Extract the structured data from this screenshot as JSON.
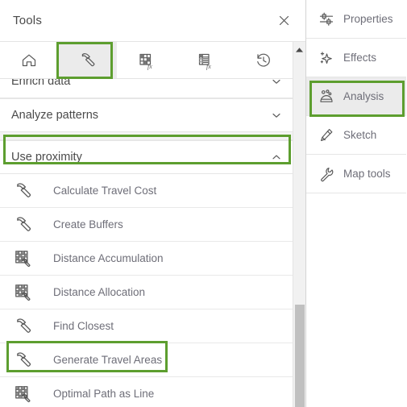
{
  "panel": {
    "title": "Tools",
    "close_icon": "close-icon"
  },
  "tabs": [
    {
      "id": "favorites",
      "icon": "home-icon",
      "selected": false
    },
    {
      "id": "toolboxes",
      "icon": "hammer-icon",
      "selected": true
    },
    {
      "id": "raster-functions",
      "icon": "raster-function-icon",
      "selected": false
    },
    {
      "id": "portal-functions",
      "icon": "table-function-icon",
      "selected": false
    },
    {
      "id": "history",
      "icon": "history-clock-icon",
      "selected": false
    }
  ],
  "sections": [
    {
      "id": "enrich-data",
      "label": "Enrich data",
      "expanded": false,
      "chevron": "chevron-down-icon"
    },
    {
      "id": "analyze-patterns",
      "label": "Analyze patterns",
      "expanded": false,
      "chevron": "chevron-down-icon"
    },
    {
      "id": "use-proximity",
      "label": "Use proximity",
      "expanded": true,
      "chevron": "chevron-up-icon"
    }
  ],
  "tools": [
    {
      "label": "Calculate Travel Cost",
      "icon": "hammer-icon"
    },
    {
      "label": "Create Buffers",
      "icon": "hammer-icon"
    },
    {
      "label": "Distance Accumulation",
      "icon": "raster-hammer-icon"
    },
    {
      "label": "Distance Allocation",
      "icon": "raster-hammer-icon"
    },
    {
      "label": "Find Closest",
      "icon": "hammer-icon"
    },
    {
      "label": "Generate Travel Areas",
      "icon": "hammer-icon"
    },
    {
      "label": "Optimal Path as Line",
      "icon": "raster-hammer-icon"
    }
  ],
  "scrollbar": {
    "up_arrow_icon": "scroll-up-arrow-icon"
  },
  "side_panel": [
    {
      "label": "Properties",
      "icon": "sliders-icon",
      "selected": false
    },
    {
      "label": "Effects",
      "icon": "sparkle-icon",
      "selected": false
    },
    {
      "label": "Analysis",
      "icon": "analysis-icon",
      "selected": true
    },
    {
      "label": "Sketch",
      "icon": "pencil-icon",
      "selected": false
    },
    {
      "label": "Map tools",
      "icon": "wrench-icon",
      "selected": false
    }
  ],
  "highlights": [
    {
      "id": "tab-toolboxes-highlight",
      "target": "hammer tab"
    },
    {
      "id": "use-proximity-highlight",
      "target": "Use proximity"
    },
    {
      "id": "generate-travel-areas-highlight",
      "target": "Generate Travel Areas"
    },
    {
      "id": "analysis-highlight",
      "target": "Analysis"
    }
  ],
  "colors": {
    "highlight_green": "#5d9e2f",
    "selected_gray": "#ebebeb",
    "text_gray": "#6e6e78",
    "title_gray": "#4a4a4a"
  }
}
